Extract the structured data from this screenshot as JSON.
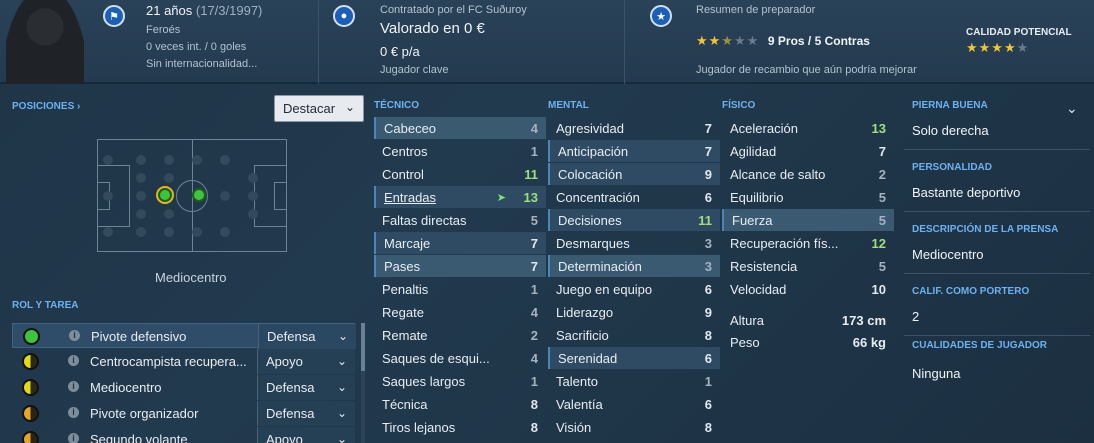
{
  "header": {
    "age": "21 años",
    "dob": "(17/3/1997)",
    "nationality": "Feroés",
    "caps": "0 veces int. / 0 goles",
    "intl_status": "Sin internacionalidad...",
    "contract_line": "Contratado por el FC Suðuroy",
    "value": "Valorado en 0 €",
    "wage": "0 € p/a",
    "squad_status": "Jugador clave",
    "report_title": "Resumen de preparador",
    "report_stars": 2.5,
    "pros_cons": "9 Pros / 5 Contras",
    "report_comment": "Jugador de recambio que aún podría mejorar",
    "potential_label": "CALIDAD POTENCIAL",
    "potential_stars": 4
  },
  "positions": {
    "title": "POSICIONES",
    "dropdown": "Destacar",
    "position_label": "Mediocentro"
  },
  "roles": {
    "title": "ROL Y TAREA",
    "items": [
      {
        "name": "Pivote defensivo",
        "duty": "Defensa",
        "selected": true,
        "indicator": "full-green"
      },
      {
        "name": "Centrocampista recupera...",
        "duty": "Apoyo",
        "selected": false,
        "indicator": "half-yellow"
      },
      {
        "name": "Mediocentro",
        "duty": "Defensa",
        "selected": false,
        "indicator": "half-yellow"
      },
      {
        "name": "Pivote organizador",
        "duty": "Defensa",
        "selected": false,
        "indicator": "half-orange"
      },
      {
        "name": "Segundo volante",
        "duty": "Apoyo",
        "selected": false,
        "indicator": "half-orange"
      }
    ]
  },
  "attributes": {
    "technical_title": "TÉCNICO",
    "mental_title": "MENTAL",
    "physical_title": "FÍSICO",
    "technical": [
      {
        "name": "Cabeceo",
        "value": "4",
        "hl": "hl2"
      },
      {
        "name": "Centros",
        "value": "1",
        "hl": ""
      },
      {
        "name": "Control",
        "value": "11",
        "hl": ""
      },
      {
        "name": "Entradas",
        "value": "13",
        "hl": "hl"
      },
      {
        "name": "Faltas directas",
        "value": "5",
        "hl": ""
      },
      {
        "name": "Marcaje",
        "value": "7",
        "hl": "hl"
      },
      {
        "name": "Pases",
        "value": "7",
        "hl": "hl2"
      },
      {
        "name": "Penaltis",
        "value": "1",
        "hl": ""
      },
      {
        "name": "Regate",
        "value": "4",
        "hl": ""
      },
      {
        "name": "Remate",
        "value": "2",
        "hl": ""
      },
      {
        "name": "Saques de esqui...",
        "value": "4",
        "hl": ""
      },
      {
        "name": "Saques largos",
        "value": "1",
        "hl": ""
      },
      {
        "name": "Técnica",
        "value": "8",
        "hl": ""
      },
      {
        "name": "Tiros lejanos",
        "value": "8",
        "hl": ""
      }
    ],
    "mental": [
      {
        "name": "Agresividad",
        "value": "7",
        "hl": ""
      },
      {
        "name": "Anticipación",
        "value": "7",
        "hl": "hl"
      },
      {
        "name": "Colocación",
        "value": "9",
        "hl": "hl"
      },
      {
        "name": "Concentración",
        "value": "6",
        "hl": ""
      },
      {
        "name": "Decisiones",
        "value": "11",
        "hl": "hl"
      },
      {
        "name": "Desmarques",
        "value": "3",
        "hl": ""
      },
      {
        "name": "Determinación",
        "value": "3",
        "hl": "hl2"
      },
      {
        "name": "Juego en equipo",
        "value": "6",
        "hl": ""
      },
      {
        "name": "Liderazgo",
        "value": "9",
        "hl": ""
      },
      {
        "name": "Sacrificio",
        "value": "8",
        "hl": ""
      },
      {
        "name": "Serenidad",
        "value": "6",
        "hl": "hl"
      },
      {
        "name": "Talento",
        "value": "1",
        "hl": ""
      },
      {
        "name": "Valentía",
        "value": "6",
        "hl": ""
      },
      {
        "name": "Visión",
        "value": "8",
        "hl": ""
      }
    ],
    "physical": [
      {
        "name": "Aceleración",
        "value": "13",
        "hl": ""
      },
      {
        "name": "Agilidad",
        "value": "7",
        "hl": ""
      },
      {
        "name": "Alcance de salto",
        "value": "2",
        "hl": ""
      },
      {
        "name": "Equilibrio",
        "value": "5",
        "hl": ""
      },
      {
        "name": "Fuerza",
        "value": "5",
        "hl": "hl2"
      },
      {
        "name": "Recuperación fís...",
        "value": "12",
        "hl": ""
      },
      {
        "name": "Resistencia",
        "value": "5",
        "hl": ""
      },
      {
        "name": "Velocidad",
        "value": "10",
        "hl": ""
      }
    ],
    "height_label": "Altura",
    "height_value": "173 cm",
    "weight_label": "Peso",
    "weight_value": "66 kg"
  },
  "sidebar": {
    "foot_title": "PIERNA BUENA",
    "foot_value": "Solo derecha",
    "personality_title": "PERSONALIDAD",
    "personality_value": "Bastante deportivo",
    "press_title": "DESCRIPCIÓN DE LA PRENSA",
    "press_value": "Mediocentro",
    "gk_title": "CALIF. COMO PORTERO",
    "gk_value": "2",
    "traits_title": "CUALIDADES DE JUGADOR",
    "traits_value": "Ninguna"
  }
}
